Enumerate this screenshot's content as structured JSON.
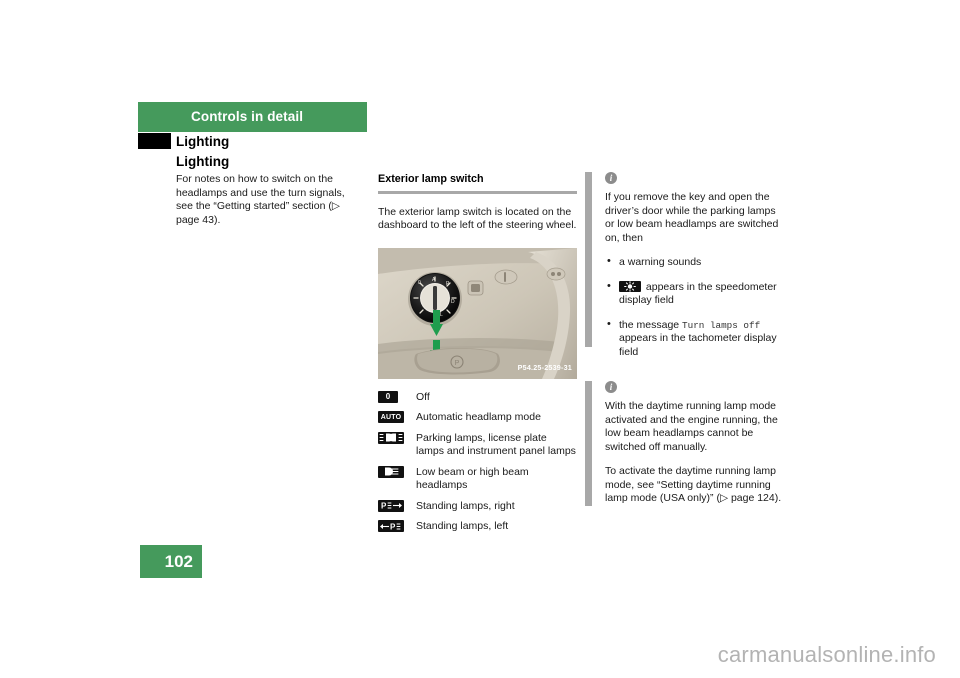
{
  "document": {
    "chapter_label": "Controls in detail",
    "section_heading": "Lighting",
    "topic_heading": "Lighting",
    "page_number": "102",
    "watermark": "carmanualsonline.info",
    "accent_color": "#459a5c",
    "rule_color": "#a8a8a8"
  },
  "column_left": {
    "paragraph": "For notes on how to switch on the headlamps and use the turn signals, see the “Getting started” section (▷ page 43)."
  },
  "column_middle": {
    "sub_heading": "Exterior lamp switch",
    "paragraph": "The exterior lamp switch is located on the dashboard to the left of the steering wheel.",
    "figure": {
      "alt": "Dashboard exterior lamp switch to the left of the steering wheel with green arrow pointing down",
      "photo_code": "P54.25-2539-31"
    },
    "legend": [
      {
        "symbol": "lamp-switch-off-icon",
        "symbol_label": "0",
        "text": "Off"
      },
      {
        "symbol": "lamp-switch-auto-icon",
        "symbol_label": "AUTO",
        "text": "Automatic headlamp mode"
      },
      {
        "symbol": "parking-lamps-icon",
        "symbol_label": "",
        "text": "Parking lamps, license plate lamps and instrument panel lamps"
      },
      {
        "symbol": "low-beam-headlamp-icon",
        "symbol_label": "",
        "text": "Low beam or high beam headlamps"
      },
      {
        "symbol": "standing-lamp-right-icon",
        "symbol_label": "",
        "text": "Standing lamps, right"
      },
      {
        "symbol": "standing-lamp-left-icon",
        "symbol_label": "",
        "text": "Standing lamps, left"
      }
    ]
  },
  "column_right": {
    "info_blocks": [
      {
        "icon": "info-icon",
        "intro": "If you remove the key and open the driver’s door while the parking lamps or low beam headlamps are switched on, then",
        "bullets": [
          {
            "text_before": "",
            "symbol": "",
            "mono": "",
            "text_after": "a warning sounds"
          },
          {
            "text_before": "",
            "symbol": "lamp-indicator-icon",
            "mono": "",
            "text_after": " appears in the speedometer display field"
          },
          {
            "text_before": "the message ",
            "symbol": "",
            "mono": "Turn lamps off",
            "text_after": " appears in the tachometer display field"
          }
        ]
      },
      {
        "icon": "info-icon",
        "paragraph_1": "With the daytime running lamp mode activated and the engine running, the low beam headlamps cannot be switched off manually.",
        "paragraph_2": "To activate the daytime running lamp mode, see “Setting daytime running lamp mode (USA only)” (▷ page 124)."
      }
    ]
  }
}
